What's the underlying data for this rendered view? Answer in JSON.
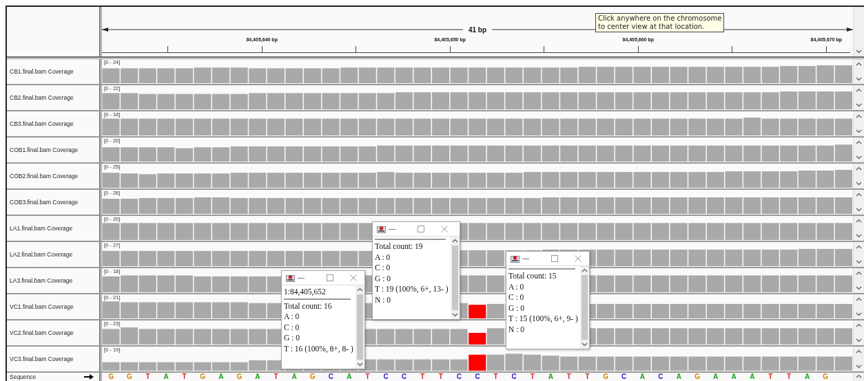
{
  "ruler": {
    "span": "41 bp",
    "labels": [
      "84,405,640 bp",
      "84,405,650 bp",
      "84,405,660 bp",
      "84,405,670 bp"
    ]
  },
  "tooltip": "Click anywhere on the chromosome\nto center view at that location.",
  "tracks": [
    {
      "name": "CB1.final.bam Coverage",
      "range": "[0 - 24]"
    },
    {
      "name": "CB2.final.bam Coverage",
      "range": "[0 - 22]"
    },
    {
      "name": "CB3.final.bam Coverage",
      "range": "[0 - 18]"
    },
    {
      "name": "COB1.final.bam Coverage",
      "range": "[0 - 20]"
    },
    {
      "name": "COB2.final.bam Coverage",
      "range": "[0 - 25]"
    },
    {
      "name": "COB3.final.bam Coverage",
      "range": "[0 - 26]"
    },
    {
      "name": "LA1.final.bam Coverage",
      "range": "[0 - 20]"
    },
    {
      "name": "LA2.final.bam Coverage",
      "range": "[0 - 27]"
    },
    {
      "name": "LA3.final.bam Coverage",
      "range": "[0 - 18]"
    },
    {
      "name": "VC1.final.bam Coverage",
      "range": "[0 - 21]"
    },
    {
      "name": "VC2.final.bam Coverage",
      "range": "[0 - 23]"
    },
    {
      "name": "VC3.final.bam Coverage",
      "range": "[0 - 19]"
    }
  ],
  "sequence": {
    "label": "Sequence",
    "bases": [
      {
        "base": "G",
        "color": "#d08000"
      },
      {
        "base": "G",
        "color": "#d08000"
      },
      {
        "base": "T",
        "color": "#e02020"
      },
      {
        "base": "A",
        "color": "#18a018"
      },
      {
        "base": "T",
        "color": "#e02020"
      },
      {
        "base": "G",
        "color": "#d08000"
      },
      {
        "base": "A",
        "color": "#18a018"
      },
      {
        "base": "G",
        "color": "#d08000"
      },
      {
        "base": "A",
        "color": "#18a018"
      },
      {
        "base": "T",
        "color": "#e02020"
      },
      {
        "base": "A",
        "color": "#18a018"
      },
      {
        "base": "G",
        "color": "#d08000"
      },
      {
        "base": "C",
        "color": "#2020d0"
      },
      {
        "base": "A",
        "color": "#18a018"
      },
      {
        "base": "T",
        "color": "#e02020"
      },
      {
        "base": "C",
        "color": "#2020d0"
      },
      {
        "base": "C",
        "color": "#2020d0"
      },
      {
        "base": "T",
        "color": "#e02020"
      },
      {
        "base": "T",
        "color": "#e02020"
      },
      {
        "base": "C",
        "color": "#2020d0"
      },
      {
        "base": "C",
        "color": "#2020d0"
      },
      {
        "base": "T",
        "color": "#e02020"
      },
      {
        "base": "C",
        "color": "#2020d0"
      },
      {
        "base": "T",
        "color": "#e02020"
      },
      {
        "base": "A",
        "color": "#18a018"
      },
      {
        "base": "T",
        "color": "#e02020"
      },
      {
        "base": "T",
        "color": "#e02020"
      },
      {
        "base": "G",
        "color": "#d08000"
      },
      {
        "base": "C",
        "color": "#2020d0"
      },
      {
        "base": "A",
        "color": "#18a018"
      },
      {
        "base": "C",
        "color": "#2020d0"
      },
      {
        "base": "A",
        "color": "#18a018"
      },
      {
        "base": "G",
        "color": "#d08000"
      },
      {
        "base": "A",
        "color": "#18a018"
      },
      {
        "base": "A",
        "color": "#18a018"
      },
      {
        "base": "A",
        "color": "#18a018"
      },
      {
        "base": "T",
        "color": "#e02020"
      },
      {
        "base": "T",
        "color": "#e02020"
      },
      {
        "base": "A",
        "color": "#18a018"
      },
      {
        "base": "G",
        "color": "#d08000"
      }
    ]
  },
  "popups": [
    {
      "location": "1:84,405,652",
      "lines": [
        "Total count: 16",
        "A : 0",
        "C : 0",
        "G : 0",
        "T : 16 (100%, 8+, 8- )"
      ]
    },
    {
      "lines": [
        "Total count: 19",
        "A : 0",
        "C : 0",
        "G : 0",
        "T : 19 (100%, 6+, 13- )",
        "N : 0"
      ]
    },
    {
      "lines": [
        "Total count: 15",
        "A : 0",
        "C : 0",
        "G : 0",
        "T : 15 (100%, 6+, 9- )",
        "N : 0"
      ]
    }
  ]
}
